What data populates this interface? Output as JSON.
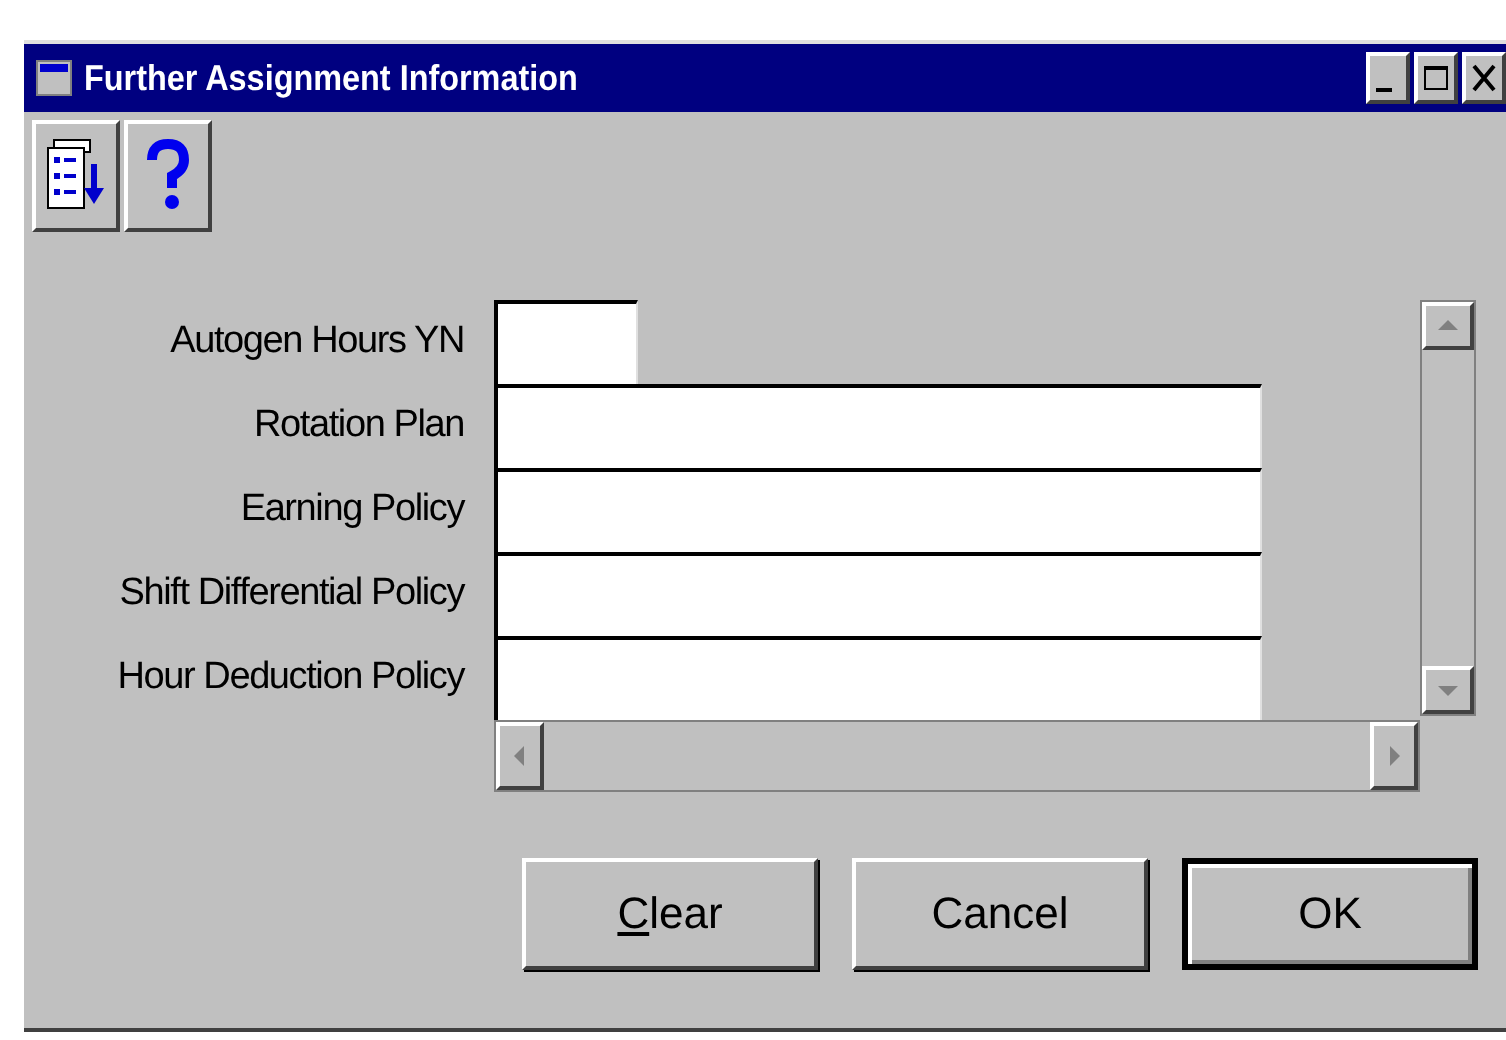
{
  "window": {
    "title": "Further Assignment Information"
  },
  "toolbar": [
    {
      "kind": "list"
    },
    {
      "kind": "help"
    }
  ],
  "fields": [
    {
      "label": "Autogen Hours YN",
      "kind": "flag"
    },
    {
      "label": "Rotation Plan",
      "kind": "text"
    },
    {
      "label": "Earning Policy",
      "kind": "text"
    },
    {
      "label": "Shift Differential Policy",
      "kind": "text"
    },
    {
      "label": "Hour Deduction Policy",
      "kind": "text"
    }
  ],
  "buttons": [
    {
      "label": "Clear",
      "underline_first": true,
      "default": false
    },
    {
      "label": "Cancel",
      "underline_first": false,
      "default": false
    },
    {
      "label": "OK",
      "underline_first": false,
      "default": true
    }
  ]
}
